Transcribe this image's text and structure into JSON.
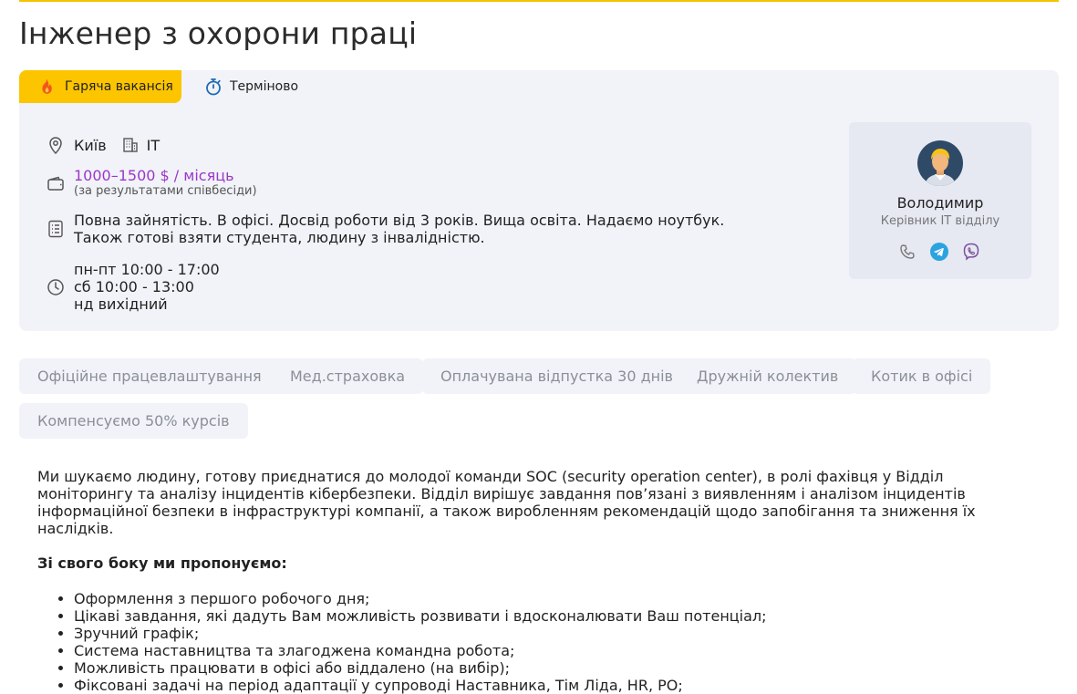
{
  "title": "Інженер з охорони праці",
  "tags": {
    "hot": "Гаряча вакансія",
    "urgent": "Терміново"
  },
  "location": {
    "city": "Київ",
    "category": "IT"
  },
  "salary": {
    "range": "1000–1500 $ / місяць",
    "note": "(за результатами співбесіди)"
  },
  "conditions": {
    "line1": "Повна зайнятість. В офісі. Досвід роботи від 3 років. Вища освіта. Надаємо ноутбук.",
    "line2": "Також готові взяти студента, людину з інвалідністю."
  },
  "schedule": [
    "пн-пт 10:00 - 17:00",
    "сб 10:00 - 13:00",
    "нд вихідний"
  ],
  "contact": {
    "name": "Володимир",
    "role": "Керівник IT відділу",
    "icons": [
      "phone-icon",
      "telegram-icon",
      "viber-icon"
    ]
  },
  "benefits": [
    "Офіційне працевлаштування",
    "Мед.страховка",
    "Оплачувана відпустка 30 днів",
    "Дружній колектив",
    "Котик в офісі",
    "Компенсуємо 50% курсів"
  ],
  "description": "Ми шукаємо людину, готову приєднатися до молодої команди SOC (security operation center), в ролі фахівця у Відділ моніторингу та аналізу інцидентів кібербезпеки. Відділ вирішує завдання пов’язані з виявленням і аналізом інцидентів інформаційної безпеки в інфраструктурі компанії, а також виробленням рекомендацій щодо запобігання та зниження їх наслідків.",
  "offer": {
    "heading": "Зі свого боку ми пропонуємо:",
    "items": [
      "Оформлення з першого робочого дня;",
      "Цікаві завдання, які дадуть Вам можливість розвивати і вдосконалювати Ваш потенціал;",
      "Зручний графік;",
      "Система наставництва та злагоджена командна робота;",
      "Можливість працювати в офісі або віддалено (на вибір);",
      "Фіксовані задачі на період адаптації у супроводі Наставника, Тім Ліда, HR, PO;"
    ]
  },
  "colors": {
    "accent": "#fcc500",
    "salary": "#9b37c9",
    "card": "#f1f3f8",
    "telegram": "#2aa3e0",
    "viber": "#7b519d"
  }
}
